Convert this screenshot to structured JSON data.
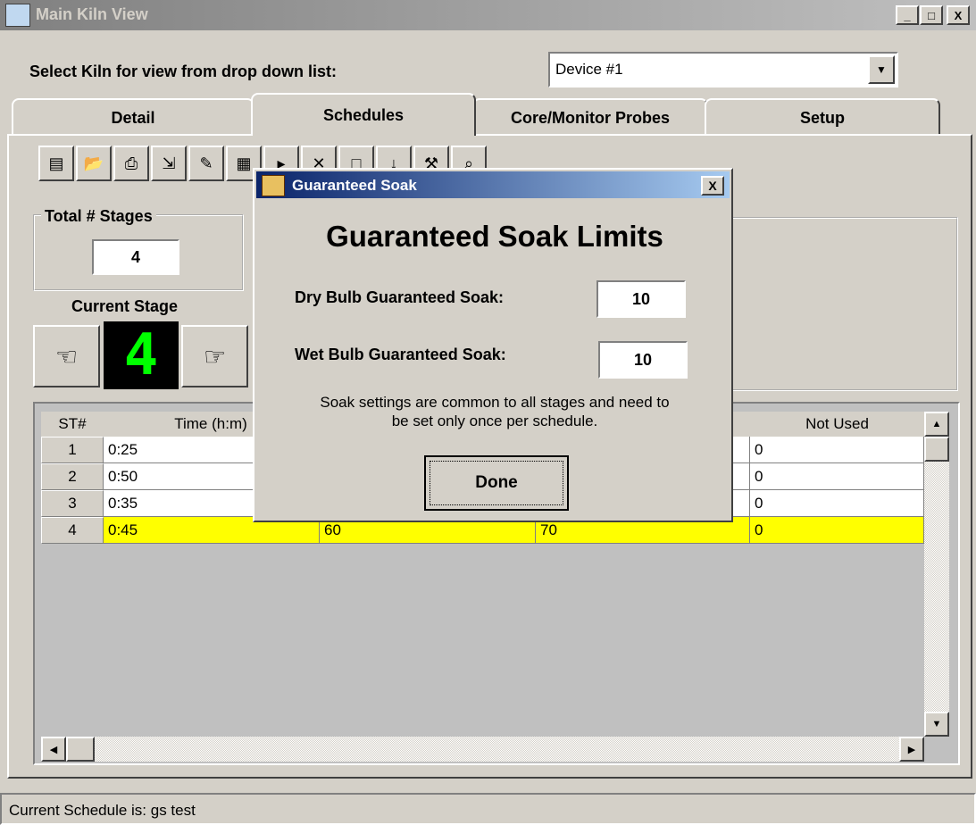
{
  "window": {
    "title": "Main Kiln View",
    "controls": [
      "_",
      "□",
      "X"
    ]
  },
  "device_selector": {
    "label": "Select Kiln for view from drop down list:",
    "value": "Device #1"
  },
  "tabs": [
    "Detail",
    "Schedules",
    "Core/Monitor Probes",
    "Setup"
  ],
  "active_tab": "Schedules",
  "stages": {
    "total_label": "Total # Stages",
    "total_value": "4",
    "current_label": "Current Stage",
    "current_value": "4"
  },
  "grid": {
    "headers": [
      "ST#",
      "Time (h:m)",
      "Not Used"
    ],
    "rows": [
      {
        "st": "1",
        "time": "0:25",
        "c3": "",
        "c4": "",
        "not_used": "0"
      },
      {
        "st": "2",
        "time": "0:50",
        "c3": "",
        "c4": "",
        "not_used": "0"
      },
      {
        "st": "3",
        "time": "0:35",
        "c3": "",
        "c4": "",
        "not_used": "0"
      },
      {
        "st": "4",
        "time": "0:45",
        "c3": "60",
        "c4": "70",
        "not_used": "0"
      }
    ],
    "highlight_color": "#ffff00"
  },
  "dialog": {
    "title": "Guaranteed Soak",
    "close": "X",
    "heading": "Guaranteed Soak Limits",
    "dry_label": "Dry Bulb Guaranteed Soak:",
    "dry_value": "10",
    "wet_label": "Wet Bulb Guaranteed Soak:",
    "wet_value": "10",
    "note_line1": "Soak settings are common to all stages and need to",
    "note_line2": "be set only once per schedule.",
    "done_label": "Done"
  },
  "status": {
    "text": "Current Schedule is: gs test"
  }
}
